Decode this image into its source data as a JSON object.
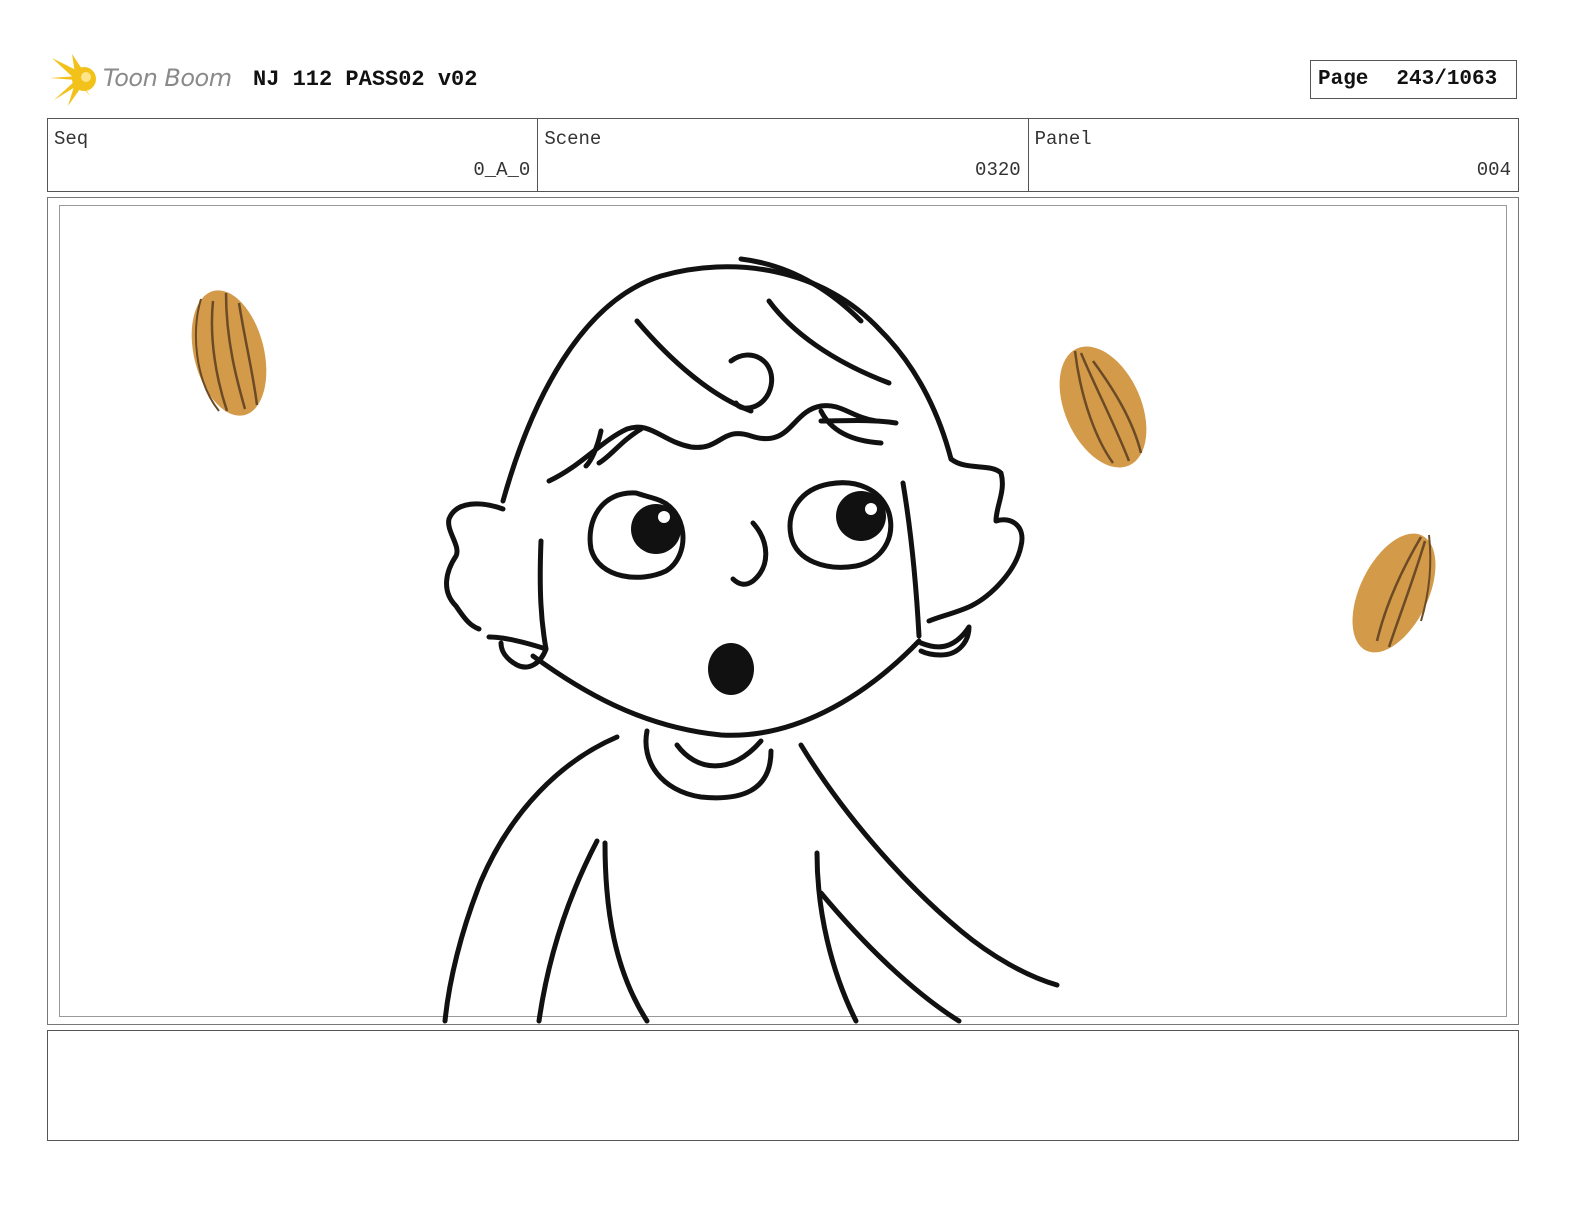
{
  "header": {
    "logo_text": "Toon Boom",
    "title": "NJ 112 PASS02 v02",
    "page_label": "Page",
    "page_value": "243/1063"
  },
  "info": {
    "seq_label": "Seq",
    "seq_value": "0_A_0",
    "scene_label": "Scene",
    "scene_value": "0320",
    "panel_label": "Panel",
    "panel_value": "004"
  },
  "colors": {
    "almond": "#d39a4a",
    "almond_line": "#6b4a26",
    "logo_star": "#f2c21b"
  },
  "icons": {
    "logo": "toon-boom-star-logo"
  }
}
